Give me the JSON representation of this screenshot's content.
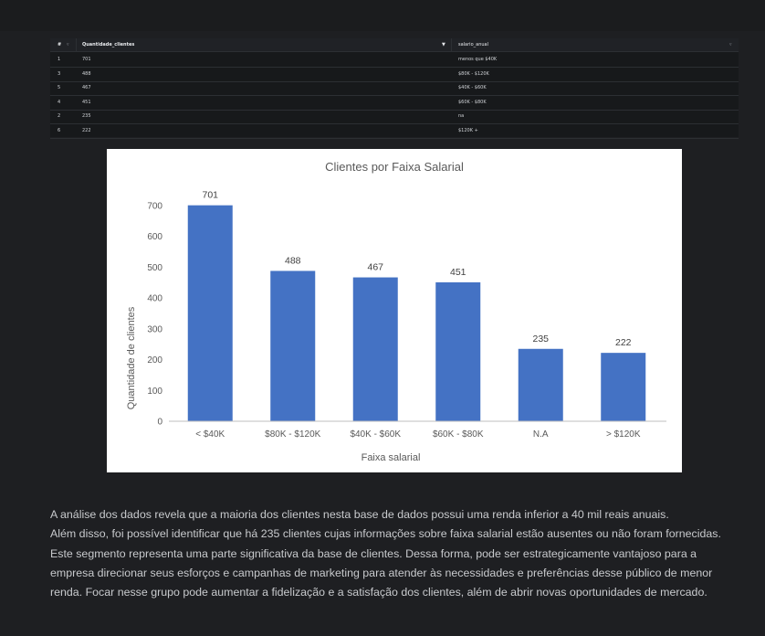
{
  "table": {
    "headers": {
      "index": "#",
      "quantidade": "Quantidade_clientes",
      "salario": "salario_anual"
    },
    "header_icons": [
      "sort-icon",
      "filter-icon",
      "dropdown-icon"
    ],
    "rows": [
      {
        "idx": "1",
        "quantidade": "701",
        "salario": "menos que $40K"
      },
      {
        "idx": "3",
        "quantidade": "488",
        "salario": "$80K - $120K"
      },
      {
        "idx": "5",
        "quantidade": "467",
        "salario": "$40K - $60K"
      },
      {
        "idx": "4",
        "quantidade": "451",
        "salario": "$60K - $80K"
      },
      {
        "idx": "2",
        "quantidade": "235",
        "salario": "na"
      },
      {
        "idx": "6",
        "quantidade": "222",
        "salario": "$120K +"
      }
    ]
  },
  "chart_data": {
    "type": "bar",
    "title": "Clientes por Faixa Salarial",
    "xlabel": "Faixa salarial",
    "ylabel": "Quantidade de clientes",
    "categories": [
      "< $40K",
      "$80K - $120K",
      "$40K - $60K",
      "$60K - $80K",
      "N.A",
      "> $120K"
    ],
    "values": [
      701,
      488,
      467,
      451,
      235,
      222
    ],
    "ylim": [
      0,
      700
    ],
    "yticks": [
      0,
      100,
      200,
      300,
      400,
      500,
      600,
      700
    ],
    "bar_color": "#4472c4",
    "data_labels": true,
    "grid": false,
    "legend": "none"
  },
  "analysis": {
    "lines": [
      "A análise dos dados revela que a maioria dos clientes nesta base de dados possui uma renda inferior a 40 mil reais anuais.",
      "Além disso, foi possível identificar que há 235 clientes cujas informações sobre faixa salarial estão ausentes ou não foram fornecidas.",
      "Este segmento representa uma parte significativa da base de clientes. Dessa forma, pode ser estrategicamente vantajoso para a",
      "empresa direcionar seus esforços e campanhas de marketing para atender às necessidades e preferências desse público de menor",
      "renda. Focar nesse grupo pode aumentar a fidelização e a satisfação dos clientes, além de abrir novas oportunidades de mercado."
    ]
  }
}
